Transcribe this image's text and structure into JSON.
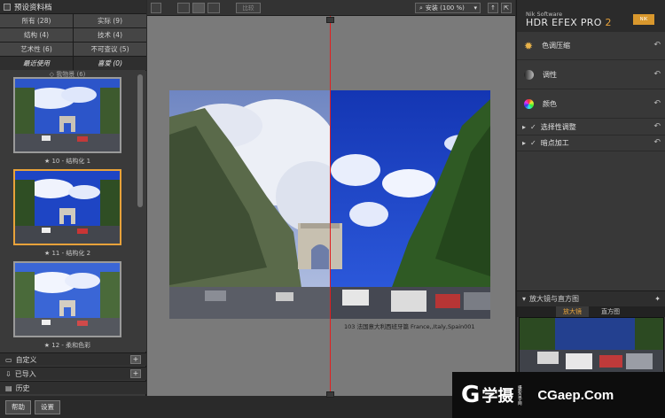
{
  "left_panel": {
    "title": "预设资料档",
    "categories": [
      {
        "label": "所有 (28)"
      },
      {
        "label": "实际 (9)"
      },
      {
        "label": "结构 (4)"
      },
      {
        "label": "技术 (4)"
      },
      {
        "label": "艺术性 (6)"
      },
      {
        "label": "不可查议 (5)"
      },
      {
        "label": "最近使用"
      },
      {
        "label": "喜爱 (0)"
      }
    ],
    "cut_label": "◇ 我物景 (6)",
    "thumbnails": [
      {
        "caption": "★ 10 - 结构化 1"
      },
      {
        "caption": "★ 11 - 结构化 2"
      },
      {
        "caption": "★ 12 - 柔和色彩"
      }
    ],
    "sections": [
      {
        "label": "自定义",
        "button": "+"
      },
      {
        "label": "已导入",
        "button": "+"
      },
      {
        "label": "历史"
      }
    ],
    "footer": {
      "help_label": "帮助",
      "settings_label": "设置"
    }
  },
  "toolbar": {
    "compare_label": "比较",
    "zoom_label": "安装 (100 %)"
  },
  "canvas": {
    "caption": "103 法国意大利西班牙篇 France,,Italy,Spain001"
  },
  "right_panel": {
    "brand_small": "Nik Software",
    "brand_title": "HDR EFEX PRO",
    "brand_version": "2",
    "logo_text": "NIK",
    "effects": [
      {
        "label": "色调压缩"
      },
      {
        "label": "调性"
      },
      {
        "label": "颜色"
      }
    ],
    "accordions": [
      {
        "label": "选择性调整"
      },
      {
        "label": "暗点加工"
      }
    ],
    "loupe_title": "放大镜与直方图",
    "loupe_tabs": [
      {
        "label": "放大镜"
      },
      {
        "label": "直方图"
      }
    ]
  },
  "watermark": {
    "glyph": "G",
    "cn_text": "学摄",
    "vertical_text": "摄影自学网",
    "domain": "CGaep.Com"
  },
  "colors": {
    "accent": "#e8a23a",
    "split_line": "#e02020",
    "canvas_bg": "#7a7a7a"
  }
}
